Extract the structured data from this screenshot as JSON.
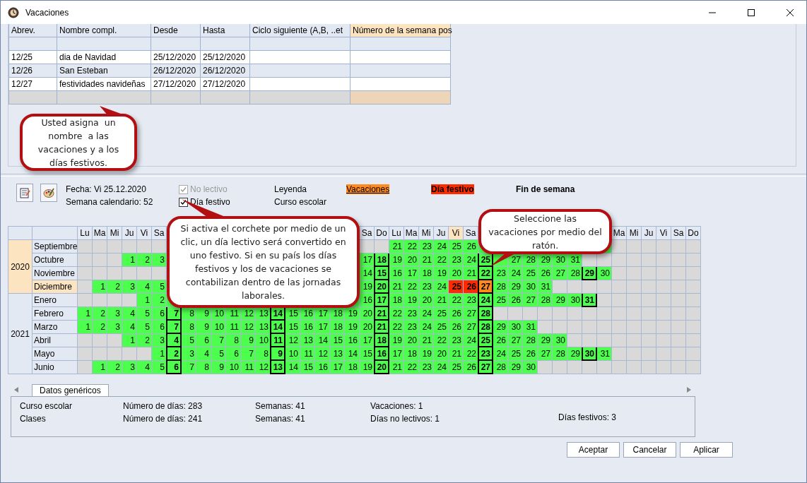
{
  "window": {
    "title": "Vacaciones"
  },
  "table": {
    "columns": [
      {
        "label": "Abrev.",
        "selected": false
      },
      {
        "label": "Nombre compl.",
        "selected": false
      },
      {
        "label": "Desde",
        "selected": false
      },
      {
        "label": "Hasta",
        "selected": false
      },
      {
        "label": "Ciclo siguiente (A,B, ..et",
        "selected": false
      },
      {
        "label": "Número de la semana pos",
        "selected": true
      }
    ],
    "rows": [
      [
        "12/25",
        "dia de Navidad",
        "25/12/2020",
        "25/12/2020"
      ],
      [
        "12/26",
        "San Esteban",
        "26/12/2020",
        "26/12/2020"
      ],
      [
        "12/27",
        "festividades navideñas",
        "27/12/2020",
        "27/12/2020"
      ]
    ]
  },
  "callouts": [
    {
      "text": "Usted asigna  un nombre  a las vacaciones y a los días festivos."
    },
    {
      "text": "Si activa el corchete por medio de un clic, un día lectivo será convertido en uno festivo. Si en su país los días festivos y los de vacaciones se contabilizan dentro de las jornadas laborales."
    },
    {
      "text": "Seleccione las vacaciones por medio del ratón."
    }
  ],
  "info": {
    "date": "Fecha: Vi 25.12.2020",
    "week": "Semana calendario: 52"
  },
  "checks": [
    {
      "label": "No lectivo",
      "checked": true,
      "disabled": true
    },
    {
      "label": "Día festivo",
      "checked": true,
      "disabled": false
    }
  ],
  "legend": {
    "title": "Leyenda",
    "subtitle": "Curso escolar",
    "items": [
      {
        "label": "Vacaciones",
        "kind": "vacation"
      },
      {
        "label": "Día festivo",
        "kind": "holiday"
      },
      {
        "label": "Fin de semana",
        "kind": "weekend"
      }
    ]
  },
  "weekdays": [
    {
      "label": "Lu",
      "selected": false
    },
    {
      "label": "Ma",
      "selected": false
    },
    {
      "label": "Mi",
      "selected": false
    },
    {
      "label": "Ju",
      "selected": false
    },
    {
      "label": "Vi",
      "selected": false
    },
    {
      "label": "Sa",
      "selected": false
    },
    {
      "kind": "covered"
    },
    {
      "kind": "covered"
    },
    {
      "kind": "covered"
    },
    {
      "kind": "covered"
    },
    {
      "kind": "covered"
    },
    {
      "kind": "covered"
    },
    {
      "kind": "covered"
    },
    {
      "kind": "covered"
    },
    {
      "kind": "covered"
    },
    {
      "kind": "covered"
    },
    {
      "kind": "covered"
    },
    {
      "kind": "covered"
    },
    {
      "kind": "covered"
    },
    {
      "label": "Sa",
      "selected": false
    },
    {
      "label": "Do",
      "selected": false
    },
    {
      "label": "Lu",
      "selected": false
    },
    {
      "label": "Ma",
      "selected": false
    },
    {
      "label": "Mi",
      "selected": false
    },
    {
      "label": "Ju",
      "selected": false
    },
    {
      "label": "Vi",
      "selected": true
    },
    {
      "label": "Sa",
      "selected": false
    },
    {
      "kind": "covered"
    },
    {
      "kind": "covered"
    },
    {
      "kind": "covered"
    },
    {
      "kind": "covered"
    },
    {
      "kind": "covered"
    },
    {
      "kind": "covered"
    },
    {
      "kind": "covered"
    },
    {
      "kind": "covered"
    },
    {
      "kind": "covered"
    },
    {
      "label": "Ma",
      "selected": false
    },
    {
      "label": "Mi",
      "selected": false
    },
    {
      "label": "Ju",
      "selected": false
    },
    {
      "label": "Vi",
      "selected": false
    },
    {
      "label": "Sa",
      "selected": false
    },
    {
      "label": "Do",
      "selected": false
    }
  ],
  "years": [
    {
      "label": "2020",
      "selected": true,
      "months": [
        {
          "name": "Septiembre",
          "selected": false,
          "days": [
            {
              "kind": "blank"
            },
            {
              "kind": "blank"
            },
            {
              "kind": "blank"
            },
            {
              "kind": "blank"
            },
            {
              "kind": "blank"
            },
            {
              "kind": "blank"
            },
            {
              "kind": "covered"
            },
            {
              "kind": "covered"
            },
            {
              "kind": "covered"
            },
            {
              "kind": "covered"
            },
            {
              "kind": "covered"
            },
            {
              "kind": "covered"
            },
            {
              "kind": "covered"
            },
            {
              "kind": "covered"
            },
            {
              "kind": "covered"
            },
            {
              "kind": "covered"
            },
            {
              "kind": "covered"
            },
            {
              "kind": "covered"
            },
            {
              "kind": "covered"
            },
            {
              "kind": "blank"
            },
            {
              "kind": "blank"
            },
            "21",
            "22",
            "23",
            "24",
            "25",
            "26",
            {
              "kind": "partial"
            },
            {
              "kind": "covered"
            },
            {
              "kind": "covered"
            },
            {
              "kind": "covered"
            },
            {
              "kind": "covered"
            },
            {
              "kind": "covered"
            },
            {
              "kind": "covered"
            },
            {
              "kind": "covered"
            },
            {
              "kind": "partial"
            }
          ]
        },
        {
          "name": "Octubre",
          "selected": false,
          "days": [
            {
              "kind": "blank"
            },
            {
              "kind": "blank"
            },
            {
              "kind": "blank"
            },
            "1",
            "2",
            "3",
            {
              "kind": "covered"
            },
            {
              "kind": "covered"
            },
            {
              "kind": "covered"
            },
            {
              "kind": "covered"
            },
            {
              "kind": "covered"
            },
            {
              "kind": "covered"
            },
            {
              "kind": "covered"
            },
            {
              "kind": "covered"
            },
            {
              "kind": "covered"
            },
            {
              "kind": "covered"
            },
            {
              "kind": "covered"
            },
            {
              "kind": "covered"
            },
            {
              "kind": "covered"
            },
            "17",
            "18",
            "19",
            "20",
            "21",
            "22",
            "23",
            "24",
            "25",
            {
              "kind": "partial"
            },
            "27",
            "28",
            "29",
            "30",
            "31"
          ]
        },
        {
          "name": "Noviembre",
          "selected": false,
          "days": [
            {
              "kind": "blank"
            },
            {
              "kind": "blank"
            },
            {
              "kind": "blank"
            },
            {
              "kind": "blank"
            },
            {
              "kind": "blank"
            },
            {
              "kind": "blank"
            },
            {
              "kind": "covered"
            },
            {
              "kind": "covered"
            },
            {
              "kind": "covered"
            },
            {
              "kind": "covered"
            },
            {
              "kind": "covered"
            },
            {
              "kind": "covered"
            },
            {
              "kind": "covered"
            },
            {
              "kind": "covered"
            },
            {
              "kind": "covered"
            },
            {
              "kind": "covered"
            },
            {
              "kind": "covered"
            },
            {
              "kind": "covered"
            },
            {
              "kind": "covered"
            },
            "14",
            "15",
            "16",
            "17",
            "18",
            "19",
            "20",
            "21",
            "22",
            "23",
            "24",
            "25",
            "26",
            "27",
            "28",
            "29",
            "30"
          ]
        },
        {
          "name": "Diciembre",
          "selected": true,
          "days": [
            {
              "kind": "blank"
            },
            "1",
            "2",
            "3",
            "4",
            "5",
            {
              "kind": "covered"
            },
            {
              "kind": "covered"
            },
            {
              "kind": "covered"
            },
            {
              "kind": "covered"
            },
            {
              "kind": "covered"
            },
            {
              "kind": "covered"
            },
            {
              "kind": "covered"
            },
            {
              "kind": "covered"
            },
            {
              "kind": "covered"
            },
            {
              "kind": "covered"
            },
            {
              "kind": "covered"
            },
            {
              "kind": "covered"
            },
            {
              "kind": "covered"
            },
            "19",
            "20",
            "21",
            "22",
            "23",
            "24",
            {
              "day": "25",
              "kind": "holiday"
            },
            {
              "day": "26",
              "kind": "holiday"
            },
            {
              "day": "27",
              "kind": "vacation"
            },
            "28",
            "29",
            "30",
            "31"
          ]
        }
      ]
    },
    {
      "label": "2021",
      "selected": false,
      "months": [
        {
          "name": "Enero",
          "selected": false,
          "days": [
            {
              "kind": "blank"
            },
            {
              "kind": "blank"
            },
            {
              "kind": "blank"
            },
            {
              "kind": "blank"
            },
            "1",
            "2",
            {
              "kind": "partial"
            },
            {
              "kind": "covered"
            },
            {
              "kind": "covered"
            },
            {
              "kind": "covered"
            },
            {
              "kind": "covered"
            },
            {
              "kind": "covered"
            },
            {
              "kind": "covered"
            },
            {
              "kind": "covered"
            },
            {
              "kind": "covered"
            },
            {
              "kind": "covered"
            },
            {
              "kind": "covered"
            },
            {
              "kind": "covered"
            },
            {
              "kind": "partial"
            },
            "16",
            "17",
            "18",
            "19",
            "20",
            "21",
            "22",
            "23",
            "24",
            "25",
            "26",
            "27",
            "28",
            "29",
            "30",
            "31"
          ]
        },
        {
          "name": "Febrero",
          "selected": false,
          "days": [
            "1",
            "2",
            "3",
            "4",
            "5",
            "6",
            "7",
            "8",
            "9",
            "10",
            "11",
            "12",
            "13",
            "14",
            "15",
            "16",
            "17",
            "18",
            "19",
            "20",
            "21",
            "22",
            "23",
            "24",
            "25",
            "26",
            "27",
            "28"
          ]
        },
        {
          "name": "Marzo",
          "selected": false,
          "days": [
            "1",
            "2",
            "3",
            "4",
            "5",
            "6",
            "7",
            "8",
            "9",
            "10",
            "11",
            "12",
            "13",
            "14",
            "15",
            "16",
            "17",
            "18",
            "19",
            "20",
            "21",
            "22",
            "23",
            "24",
            "25",
            "26",
            "27",
            "28",
            "29",
            "30",
            "31"
          ]
        },
        {
          "name": "Abril",
          "selected": false,
          "days": [
            {
              "kind": "blank"
            },
            {
              "kind": "blank"
            },
            {
              "kind": "blank"
            },
            "1",
            "2",
            "3",
            "4",
            "5",
            "6",
            "7",
            "8",
            "9",
            "10",
            "11",
            "12",
            "13",
            "14",
            "15",
            "16",
            "17",
            "18",
            "19",
            "20",
            "21",
            "22",
            "23",
            "24",
            "25",
            "26",
            "27",
            "28",
            "29",
            "30"
          ]
        },
        {
          "name": "Mayo",
          "selected": false,
          "days": [
            {
              "kind": "blank"
            },
            {
              "kind": "blank"
            },
            {
              "kind": "blank"
            },
            {
              "kind": "blank"
            },
            {
              "kind": "blank"
            },
            "1",
            "2",
            "3",
            "4",
            "5",
            "6",
            "7",
            "8",
            "9",
            "10",
            "11",
            "12",
            "13",
            "14",
            "15",
            "16",
            "17",
            "18",
            "19",
            "20",
            "21",
            "22",
            "23",
            "24",
            "25",
            "26",
            "27",
            "28",
            "29",
            "30",
            "31"
          ]
        },
        {
          "name": "Junio",
          "selected": false,
          "days": [
            {
              "kind": "blank"
            },
            "1",
            "2",
            "3",
            "4",
            "5",
            "6",
            "7",
            "8",
            "9",
            "10",
            "11",
            "12",
            "13",
            "14",
            "15",
            "16",
            "17",
            "18",
            "19",
            "20",
            "21",
            "22",
            "23",
            "24",
            "25",
            "26",
            "27",
            "28",
            "29",
            "30"
          ]
        }
      ]
    }
  ],
  "tabs": [
    {
      "label": "Datos genéricos",
      "selected": true
    }
  ],
  "stats": [
    {
      "label": "Curso escolar",
      "cells": [
        "Número de días: 283",
        "Semanas: 41",
        "Vacaciones: 1"
      ]
    },
    {
      "label": "Clases",
      "cells": [
        "Número de días: 241",
        "Semanas: 41",
        "Días no lectivos: 1",
        "Días festivos: 3"
      ]
    }
  ],
  "buttons": [
    "Aceptar",
    "Cancelar",
    "Aplicar"
  ]
}
